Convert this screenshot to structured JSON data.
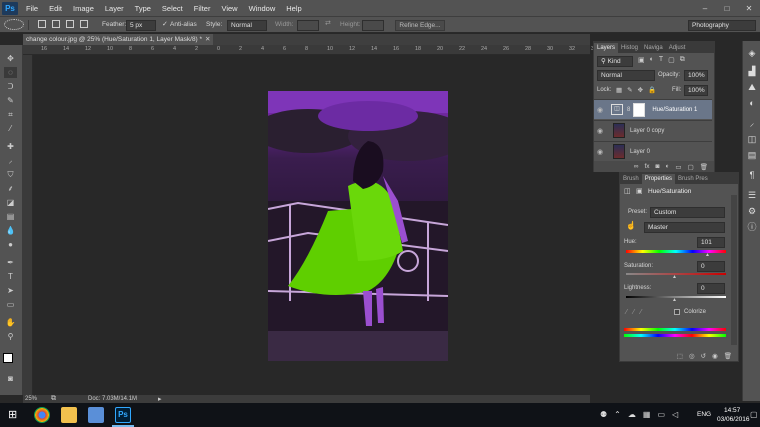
{
  "app": {
    "logo": "Ps"
  },
  "menu": [
    "File",
    "Edit",
    "Image",
    "Layer",
    "Type",
    "Select",
    "Filter",
    "View",
    "Window",
    "Help"
  ],
  "options": {
    "feather_label": "Feather:",
    "feather_value": "5 px",
    "antialias_label": "Anti-alias",
    "style_label": "Style:",
    "style_value": "Normal",
    "width_label": "Width:",
    "height_label": "Height:",
    "refine_edge": "Refine Edge...",
    "workspace": "Photography"
  },
  "document": {
    "tab_title": "change colour.jpg @ 25% (Hue/Saturation 1, Layer Mask/8) *",
    "zoom": "25%",
    "doc_size": "Doc: 7.03M/14.1M"
  },
  "ruler": {
    "top_ticks": [
      "16",
      "14",
      "12",
      "10",
      "8",
      "6",
      "4",
      "2",
      "0",
      "2",
      "4",
      "6",
      "8",
      "10",
      "12",
      "14",
      "16",
      "18",
      "20",
      "22",
      "24",
      "26",
      "28",
      "30",
      "32",
      "34"
    ]
  },
  "layers_panel": {
    "tabs": [
      "Layers",
      "Histog",
      "Naviga",
      "Adjust"
    ],
    "filter": "Kind",
    "blend_mode": "Normal",
    "opacity_label": "Opacity:",
    "opacity_value": "100%",
    "lock_label": "Lock:",
    "fill_label": "Fill:",
    "fill_value": "100%",
    "layers": [
      {
        "name": "Hue/Saturation 1"
      },
      {
        "name": "Layer 0 copy"
      },
      {
        "name": "Layer 0"
      }
    ],
    "footer_icons": "fx"
  },
  "properties_panel": {
    "tabs": [
      "Brush",
      "Properties",
      "Brush Pres"
    ],
    "title": "Hue/Saturation",
    "preset_label": "Preset:",
    "preset_value": "Custom",
    "channel_value": "Master",
    "hue_label": "Hue:",
    "hue_value": "101",
    "saturation_label": "Saturation:",
    "saturation_value": "0",
    "lightness_label": "Lightness:",
    "lightness_value": "0",
    "colorize_label": "Colorize"
  },
  "taskbar": {
    "language": "ENG",
    "time": "14:57",
    "date": "03/06/2016"
  }
}
